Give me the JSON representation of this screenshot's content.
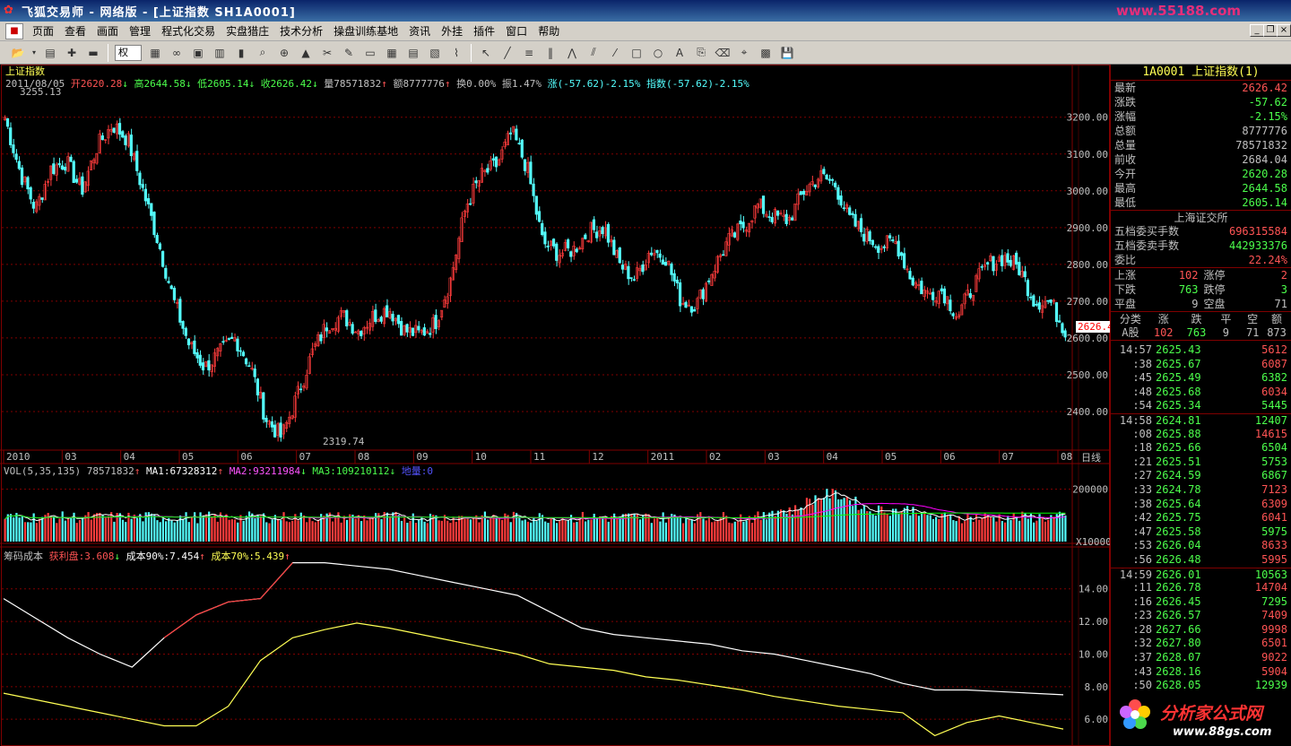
{
  "window": {
    "title": "飞狐交易师 - 网络版 - [上证指数 SH1A0001]",
    "watermark": "www.55188.com"
  },
  "menu": [
    "页面",
    "查看",
    "画面",
    "管理",
    "程式化交易",
    "实盘猎庄",
    "技术分析",
    "操盘训练基地",
    "资讯",
    "外挂",
    "插件",
    "窗口",
    "帮助"
  ],
  "toolbar": {
    "period_select": "权"
  },
  "chart": {
    "name": "上证指数",
    "info": {
      "date": "2011/08/05",
      "open": "开2620.28",
      "high": "高2644.58",
      "low": "低2605.14",
      "close": "收2626.42",
      "vol": "量78571832",
      "amount": "额8777776",
      "turnover": "换0.00%",
      "amplitude": "振1.47%",
      "change": "涨(-57.62)-2.15%",
      "index": "指数(-57.62)-2.15%"
    },
    "max_label": "3255.13",
    "min_label": "2319.74",
    "current_price_tag": "2626.4",
    "period_label": "日线",
    "vol_axis_unit": "X10000",
    "vol_info": {
      "name": "VOL(5,35,135)",
      "value": "78571832",
      "ma1": "MA1:67328312",
      "ma2": "MA2:93211984",
      "ma3": "MA3:109210112",
      "dl": "地量:0"
    },
    "cost_info": {
      "name": "筹码成本",
      "profit": "获利盘:3.608",
      "cost90": "成本90%:7.454",
      "cost70": "成本70%:5.439"
    }
  },
  "chart_data": {
    "type": "candlestick",
    "x_ticks": [
      "2010",
      "03",
      "04",
      "05",
      "06",
      "07",
      "08",
      "09",
      "10",
      "11",
      "12",
      "2011",
      "02",
      "03",
      "04",
      "05",
      "06",
      "07",
      "08"
    ],
    "price_axis": [
      3200,
      3100,
      3000,
      2900,
      2800,
      2700,
      2600,
      2500,
      2400
    ],
    "price_ylim": [
      2300,
      3270
    ],
    "vol_axis": [
      200000
    ],
    "vol_ylim": [
      0,
      260000
    ],
    "cost_axis": [
      14,
      12,
      10,
      8,
      6
    ],
    "cost_ylim": [
      4.8,
      15.8
    ],
    "close_path": [
      3200,
      3050,
      2950,
      3060,
      3080,
      3000,
      3120,
      3180,
      3140,
      3000,
      2860,
      2700,
      2580,
      2520,
      2560,
      2600,
      2520,
      2380,
      2330,
      2440,
      2560,
      2640,
      2660,
      2620,
      2660,
      2680,
      2620,
      2610,
      2640,
      2760,
      2960,
      3040,
      3070,
      3160,
      3060,
      2860,
      2830,
      2840,
      2890,
      2900,
      2800,
      2760,
      2840,
      2820,
      2700,
      2690,
      2780,
      2860,
      2900,
      2960,
      2930,
      2920,
      3000,
      3040,
      3020,
      2920,
      2880,
      2850,
      2860,
      2760,
      2720,
      2730,
      2660,
      2740,
      2800,
      2820,
      2790,
      2700,
      2700,
      2620
    ],
    "cost_curves": {
      "c90": [
        13.4,
        12.2,
        11.0,
        10.0,
        9.2,
        11.0,
        12.4,
        13.2,
        13.4,
        15.6,
        15.6,
        15.4,
        15.2,
        14.8,
        14.4,
        14.0,
        13.6,
        12.6,
        11.6,
        11.2,
        11.0,
        10.8,
        10.6,
        10.2,
        10.0,
        9.6,
        9.2,
        8.8,
        8.2,
        7.8,
        7.8,
        7.7,
        7.6,
        7.5
      ],
      "c70": [
        7.6,
        7.2,
        6.8,
        6.4,
        6.0,
        5.6,
        5.6,
        6.8,
        9.6,
        11.0,
        11.5,
        11.9,
        11.6,
        11.2,
        10.8,
        10.4,
        10.0,
        9.4,
        9.2,
        9.0,
        8.6,
        8.4,
        8.1,
        7.8,
        7.4,
        7.1,
        6.8,
        6.6,
        6.4,
        5.0,
        5.8,
        6.2,
        5.8,
        5.4
      ],
      "profit": [
        null,
        null,
        null,
        null,
        null,
        11.0,
        12.4,
        13.2,
        13.4,
        15.6
      ]
    }
  },
  "panel": {
    "title": "1A0001 上证指数(1)",
    "quote": [
      {
        "label": "最新",
        "value": "2626.42",
        "color": "#ff5454"
      },
      {
        "label": "涨跌",
        "value": "-57.62",
        "color": "#4cff4c"
      },
      {
        "label": "涨幅",
        "value": "-2.15%",
        "color": "#4cff4c"
      },
      {
        "label": "总额",
        "value": "8777776",
        "color": "#c0c0c0"
      },
      {
        "label": "总量",
        "value": "78571832",
        "color": "#c0c0c0"
      },
      {
        "label": "前收",
        "value": "2684.04",
        "color": "#c0c0c0"
      },
      {
        "label": "今开",
        "value": "2620.28",
        "color": "#4cff4c"
      },
      {
        "label": "最高",
        "value": "2644.58",
        "color": "#4cff4c"
      },
      {
        "label": "最低",
        "value": "2605.14",
        "color": "#4cff4c"
      }
    ],
    "exchange": "上海证交所",
    "orders": [
      {
        "label": "五档委买手数",
        "value": "696315584",
        "color": "#ff5454"
      },
      {
        "label": "五档委卖手数",
        "value": "442933376",
        "color": "#4cff4c"
      },
      {
        "label": "委比",
        "value": "22.24%",
        "color": "#ff5454"
      }
    ],
    "breadth": [
      {
        "l1": "上涨",
        "v1": "102",
        "c1": "#ff5454",
        "l2": "涨停",
        "v2": "2",
        "c2": "#ff5454"
      },
      {
        "l1": "下跌",
        "v1": "763",
        "c1": "#4cff4c",
        "l2": "跌停",
        "v2": "3",
        "c2": "#4cff4c"
      },
      {
        "l1": "平盘",
        "v1": "9",
        "c1": "#c0c0c0",
        "l2": "空盘",
        "v2": "71",
        "c2": "#c0c0c0"
      }
    ],
    "class_header": [
      "分类",
      "涨",
      "跌",
      "平",
      "空",
      "额"
    ],
    "class_row": [
      "A股",
      "102",
      "763",
      "9",
      "71",
      "873"
    ],
    "ticks": [
      {
        "t": "14:57",
        "p": "2625.43",
        "v": "5612",
        "vc": "#ff5454"
      },
      {
        "t": ":38",
        "p": "2625.67",
        "v": "6087",
        "vc": "#ff5454"
      },
      {
        "t": ":45",
        "p": "2625.49",
        "v": "6382",
        "vc": "#4cff4c"
      },
      {
        "t": ":48",
        "p": "2625.68",
        "v": "6034",
        "vc": "#ff5454"
      },
      {
        "t": ":54",
        "p": "2625.34",
        "v": "5445",
        "vc": "#4cff4c"
      },
      {
        "t": "14:58",
        "p": "2624.81",
        "v": "12407",
        "vc": "#4cff4c"
      },
      {
        "t": ":08",
        "p": "2625.88",
        "v": "14615",
        "vc": "#ff5454"
      },
      {
        "t": ":18",
        "p": "2625.66",
        "v": "6504",
        "vc": "#4cff4c"
      },
      {
        "t": ":21",
        "p": "2625.51",
        "v": "5753",
        "vc": "#4cff4c"
      },
      {
        "t": ":27",
        "p": "2624.59",
        "v": "6867",
        "vc": "#4cff4c"
      },
      {
        "t": ":33",
        "p": "2624.78",
        "v": "7123",
        "vc": "#ff5454"
      },
      {
        "t": ":38",
        "p": "2625.64",
        "v": "6309",
        "vc": "#ff5454"
      },
      {
        "t": ":42",
        "p": "2625.75",
        "v": "6041",
        "vc": "#ff5454"
      },
      {
        "t": ":47",
        "p": "2625.58",
        "v": "5975",
        "vc": "#4cff4c"
      },
      {
        "t": ":53",
        "p": "2626.04",
        "v": "8633",
        "vc": "#ff5454"
      },
      {
        "t": ":56",
        "p": "2626.48",
        "v": "5995",
        "vc": "#ff5454"
      },
      {
        "t": "14:59",
        "p": "2626.01",
        "v": "10563",
        "vc": "#4cff4c"
      },
      {
        "t": ":11",
        "p": "2626.78",
        "v": "14704",
        "vc": "#ff5454"
      },
      {
        "t": ":16",
        "p": "2626.45",
        "v": "7295",
        "vc": "#4cff4c"
      },
      {
        "t": ":23",
        "p": "2626.57",
        "v": "7409",
        "vc": "#ff5454"
      },
      {
        "t": ":28",
        "p": "2627.66",
        "v": "9998",
        "vc": "#ff5454"
      },
      {
        "t": ":32",
        "p": "2627.80",
        "v": "6501",
        "vc": "#ff5454"
      },
      {
        "t": ":37",
        "p": "2628.07",
        "v": "9022",
        "vc": "#ff5454"
      },
      {
        "t": ":43",
        "p": "2628.16",
        "v": "5904",
        "vc": "#ff5454"
      },
      {
        "t": ":50",
        "p": "2628.05",
        "v": "12939",
        "vc": "#4cff4c"
      }
    ],
    "logo_text": "分析家公式网",
    "logo_url": "www.88gs.com"
  },
  "colors": {
    "up": "#ff3c3c",
    "down": "#54ffff",
    "grid": "#800000",
    "white_line": "#ffffff",
    "yellow": "#ffff00",
    "magenta": "#ff00ff",
    "green": "#00ff00"
  }
}
